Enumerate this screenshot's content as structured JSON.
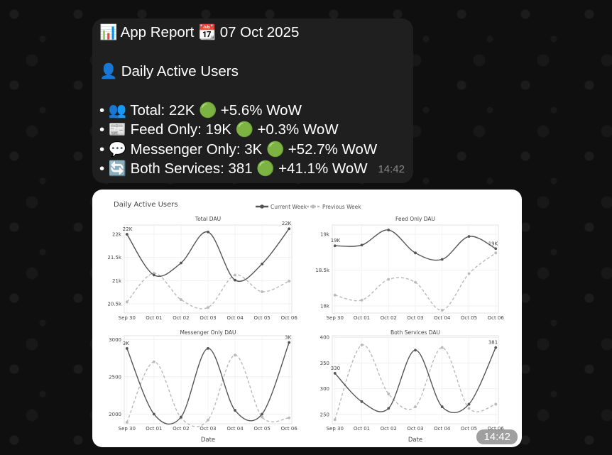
{
  "message": {
    "lines": [
      {
        "emoji": "📊",
        "text": "App Report"
      },
      {
        "emoji": "📆",
        "text": "07 Oct 2025"
      },
      {
        "emoji": "👤",
        "text": "Daily Active Users"
      },
      {
        "bullet": "•",
        "emoji": "👥",
        "text": "Total: 22K",
        "status": "🟢",
        "delta": "+5.6% WoW"
      },
      {
        "bullet": "•",
        "emoji": "📰",
        "text": "Feed Only: 19K",
        "status": "🟢",
        "delta": "+0.3% WoW"
      },
      {
        "bullet": "•",
        "emoji": "💬",
        "text": "Messenger Only: 3K",
        "status": "🟢",
        "delta": "+52.7% WoW"
      },
      {
        "bullet": "•",
        "emoji": "🔄",
        "text": "Both Services: 381",
        "status": "🟢",
        "delta": "+41.1% WoW"
      }
    ],
    "time": "14:42"
  },
  "image_message": {
    "time": "14:42",
    "figure_title": "Daily Active Users"
  },
  "colors": {
    "current": "#555555",
    "previous": "#b8b8b8",
    "bubble": "#1f1f1f"
  },
  "chart_data": [
    {
      "type": "line",
      "title": "Total DAU",
      "xlabel": "",
      "x": [
        "Sep 30",
        "Oct 01",
        "Oct 02",
        "Oct 03",
        "Oct 04",
        "Oct 05",
        "Oct 06"
      ],
      "ylim": [
        20300,
        22200
      ],
      "yticks": [
        20500,
        21000,
        21500,
        22000
      ],
      "ytick_labels": [
        "20.5k",
        "21k",
        "21.5k",
        "22k"
      ],
      "series": [
        {
          "name": "Current Week",
          "values": [
            22000,
            21120,
            21380,
            22050,
            21010,
            21360,
            22120
          ],
          "style": "solid"
        },
        {
          "name": "Previous Week",
          "values": [
            20540,
            21160,
            20590,
            20420,
            21120,
            20760,
            20990
          ],
          "style": "dashed"
        }
      ],
      "labels": [
        {
          "index": 0,
          "text": "22K"
        },
        {
          "index": 6,
          "text": "22K"
        }
      ]
    },
    {
      "type": "line",
      "title": "Feed Only DAU",
      "xlabel": "",
      "x": [
        "Sep 30",
        "Oct 01",
        "Oct 02",
        "Oct 03",
        "Oct 04",
        "Oct 05",
        "Oct 06"
      ],
      "ylim": [
        17900,
        19130
      ],
      "yticks": [
        18000,
        18500,
        19000
      ],
      "ytick_labels": [
        "18k",
        "18.5k",
        "19k"
      ],
      "series": [
        {
          "name": "Current Week",
          "values": [
            18840,
            18850,
            19060,
            18740,
            18650,
            18970,
            18800
          ],
          "style": "solid"
        },
        {
          "name": "Previous Week",
          "values": [
            18150,
            18080,
            18370,
            18330,
            17940,
            18450,
            18740
          ],
          "style": "dashed"
        }
      ],
      "labels": [
        {
          "index": 0,
          "text": "19K"
        },
        {
          "index": 6,
          "text": "19K"
        }
      ]
    },
    {
      "type": "line",
      "title": "Messenger Only DAU",
      "xlabel": "Date",
      "x": [
        "Sep 30",
        "Oct 01",
        "Oct 02",
        "Oct 03",
        "Oct 04",
        "Oct 05",
        "Oct 06"
      ],
      "ylim": [
        1870,
        3050
      ],
      "yticks": [
        2000,
        2500,
        3000
      ],
      "ytick_labels": [
        "2000",
        "2500",
        "3000"
      ],
      "series": [
        {
          "name": "Current Week",
          "values": [
            2880,
            2000,
            1960,
            2880,
            2050,
            2000,
            2960
          ],
          "style": "solid"
        },
        {
          "name": "Previous Week",
          "values": [
            1890,
            2700,
            1950,
            1920,
            2790,
            1960,
            1950
          ],
          "style": "dashed"
        }
      ],
      "labels": [
        {
          "index": 0,
          "text": "3K"
        },
        {
          "index": 6,
          "text": "3K"
        }
      ]
    },
    {
      "type": "line",
      "title": "Both Services DAU",
      "xlabel": "Date",
      "x": [
        "Sep 30",
        "Oct 01",
        "Oct 02",
        "Oct 03",
        "Oct 04",
        "Oct 05",
        "Oct 06"
      ],
      "ylim": [
        232,
        403
      ],
      "yticks": [
        250,
        300,
        350,
        400
      ],
      "ytick_labels": [
        "250",
        "300",
        "350",
        "400"
      ],
      "series": [
        {
          "name": "Current Week",
          "values": [
            330,
            275,
            262,
            375,
            265,
            270,
            380
          ],
          "style": "solid"
        },
        {
          "name": "Previous Week",
          "values": [
            240,
            385,
            290,
            265,
            380,
            262,
            270
          ],
          "style": "dashed"
        }
      ],
      "labels": [
        {
          "index": 0,
          "text": "330"
        },
        {
          "index": 6,
          "text": "381"
        }
      ]
    }
  ]
}
